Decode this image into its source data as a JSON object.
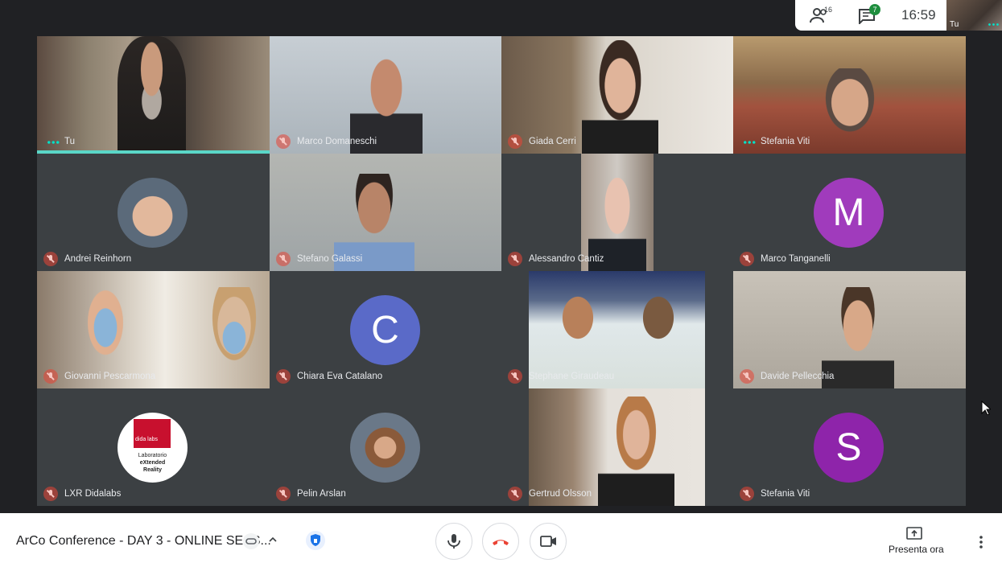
{
  "header": {
    "participants_count": "16",
    "chat_count": "7",
    "time": "16:59",
    "self_label": "Tu"
  },
  "tiles": [
    {
      "name": "Tu",
      "type": "video",
      "speaking": true
    },
    {
      "name": "Marco Domaneschi",
      "type": "video"
    },
    {
      "name": "Giada Cerri",
      "type": "video"
    },
    {
      "name": "Stefania Viti",
      "type": "video"
    },
    {
      "name": "Andrei Reinhorn",
      "type": "avatar-photo"
    },
    {
      "name": "Stefano Galassi",
      "type": "video"
    },
    {
      "name": "Alessandro Cantiz",
      "type": "video"
    },
    {
      "name": "Marco Tanganelli",
      "type": "letter",
      "letter": "M",
      "color": "#a03bbc"
    },
    {
      "name": "Giovanni Pescarmona",
      "type": "video"
    },
    {
      "name": "Chiara Eva Catalano",
      "type": "letter",
      "letter": "C",
      "color": "#5a6ac8"
    },
    {
      "name": "Stephane Giraudeau",
      "type": "video"
    },
    {
      "name": "Davide Pellecchia",
      "type": "video"
    },
    {
      "name": "LXR Didalabs",
      "type": "logo",
      "logo_lines": [
        "dida labs",
        "Laboratorio",
        "eXtended",
        "Reality"
      ]
    },
    {
      "name": "Pelin Arslan",
      "type": "avatar-photo"
    },
    {
      "name": "Gertrud Olsson",
      "type": "video"
    },
    {
      "name": "Stefania Viti",
      "type": "letter",
      "letter": "S",
      "color": "#8e24aa"
    }
  ],
  "bottombar": {
    "meeting_title": "ArCo Conference - DAY 3 - ONLINE SESS...",
    "present_label": "Presenta ora"
  },
  "colors": {
    "background": "#202124",
    "tile": "#3c4043",
    "speaking_bar": "#5ad7c8",
    "end_call": "#ea4335"
  }
}
